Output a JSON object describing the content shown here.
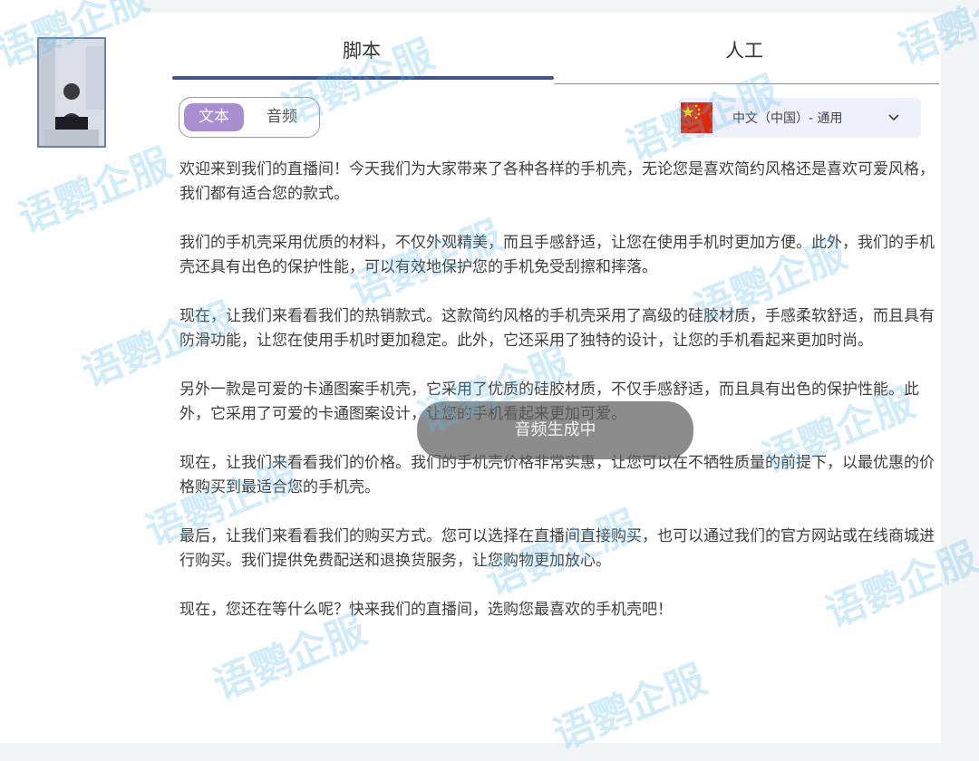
{
  "tabs": [
    {
      "label": "脚本",
      "active": true
    },
    {
      "label": "人工",
      "active": false
    }
  ],
  "mode_toggle": {
    "options": [
      {
        "label": "文本",
        "selected": true
      },
      {
        "label": "音频",
        "selected": false
      }
    ]
  },
  "language": {
    "label": "中文（中国）- 通用",
    "flag_icon": "china-flag-icon",
    "dropdown_icon": "chevron-down-icon"
  },
  "script": {
    "paragraphs": [
      "欢迎来到我们的直播间！今天我们为大家带来了各种各样的手机壳，无论您是喜欢简约风格还是喜欢可爱风格，我们都有适合您的款式。",
      "我们的手机壳采用优质的材料，不仅外观精美，而且手感舒适，让您在使用手机时更加方便。此外，我们的手机壳还具有出色的保护性能，可以有效地保护您的手机免受刮擦和摔落。",
      "现在，让我们来看看我们的热销款式。这款简约风格的手机壳采用了高级的硅胶材质，手感柔软舒适，而且具有防滑功能，让您在使用手机时更加稳定。此外，它还采用了独特的设计，让您的手机看起来更加时尚。",
      "另外一款是可爱的卡通图案手机壳，它采用了优质的硅胶材质，不仅手感舒适，而且具有出色的保护性能。此外，它采用了可爱的卡通图案设计，让您的手机看起来更加可爱。",
      "现在，让我们来看看我们的价格。我们的手机壳价格非常实惠，让您可以在不牺牲质量的前提下，以最优惠的价格购买到最适合您的手机壳。",
      "最后，让我们来看看我们的购买方式。您可以选择在直播间直接购买，也可以通过我们的官方网站或在线商城进行购买。我们提供免费配送和退换货服务，让您购物更加放心。",
      "现在，您还在等什么呢？快来我们的直播间，选购您最喜欢的手机壳吧！"
    ]
  },
  "toast": {
    "text": "音频生成中"
  },
  "watermark": {
    "text": "语鹦企服"
  },
  "colors": {
    "accent": "#3e5689",
    "toggle_selected": "#a98ed0",
    "watermark": "#5fbeeb"
  }
}
